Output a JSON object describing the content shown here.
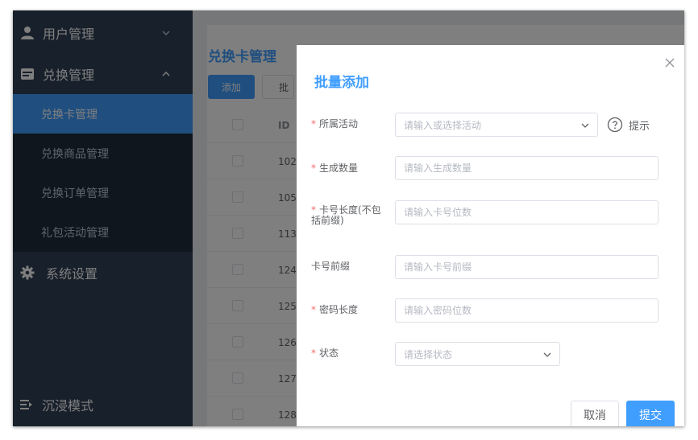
{
  "sidebar": {
    "menus": [
      {
        "label": "用户管理",
        "icon": "user-icon",
        "arrow": "chevron-down-icon"
      },
      {
        "label": "兑换管理",
        "icon": "card-icon",
        "arrow": "chevron-up-icon"
      }
    ],
    "submenu": [
      {
        "label": "兑换卡管理",
        "active": true
      },
      {
        "label": "兑换商品管理",
        "active": false
      },
      {
        "label": "兑换订单管理",
        "active": false
      },
      {
        "label": "礼包活动管理",
        "active": false
      }
    ],
    "settings": {
      "label": "系统设置",
      "icon": "gear-icon"
    },
    "footer": {
      "label": "沉浸模式",
      "icon": "immersive-mode-icon"
    }
  },
  "page": {
    "title": "兑换卡管理",
    "add_label": "添加",
    "batch_label": "批",
    "table": {
      "header": "ID",
      "rows": [
        "102",
        "105",
        "113",
        "124",
        "125",
        "126",
        "127",
        "128"
      ]
    }
  },
  "drawer": {
    "title": "批量添加",
    "close_icon": "close-icon",
    "fields": {
      "activity": {
        "label": "所属活动",
        "placeholder": "请输入或选择活动"
      },
      "hint": "提示",
      "count": {
        "label": "生成数量",
        "placeholder": "请输入生成数量"
      },
      "card_length": {
        "label": "卡号长度(不包括前缀)",
        "placeholder": "请输入卡号位数"
      },
      "prefix": {
        "label": "卡号前缀",
        "placeholder": "请输入卡号前缀"
      },
      "password_length": {
        "label": "密码长度",
        "placeholder": "请输入密码位数"
      },
      "status": {
        "label": "状态",
        "placeholder": "请选择状态"
      }
    },
    "cancel_label": "取消",
    "submit_label": "提交"
  },
  "colors": {
    "sidebar_bg": "#304156",
    "submenu_bg": "#1f2d3d",
    "accent": "#409eff",
    "required": "#f56c6c"
  }
}
